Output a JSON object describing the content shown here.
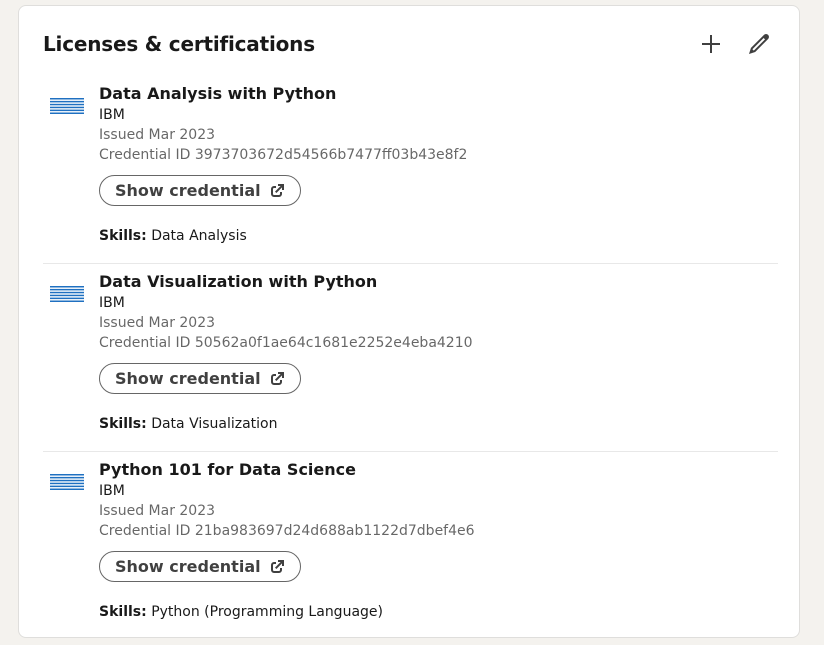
{
  "section": {
    "title": "Licenses & certifications",
    "add_icon": "plus-icon",
    "edit_icon": "pencil-icon"
  },
  "skills_label": "Skills:",
  "certs": [
    {
      "name": "Data Analysis with Python",
      "issuer": "IBM",
      "issued": "Issued Mar 2023",
      "credential": "Credential ID 3973703672d54566b7477ff03b43e8f2",
      "button": "Show credential",
      "skills": "Data Analysis",
      "logo": "IBM"
    },
    {
      "name": "Data Visualization with Python",
      "issuer": "IBM",
      "issued": "Issued Mar 2023",
      "credential": "Credential ID 50562a0f1ae64c1681e2252e4eba4210",
      "button": "Show credential",
      "skills": "Data Visualization",
      "logo": "IBM"
    },
    {
      "name": "Python 101 for Data Science",
      "issuer": "IBM",
      "issued": "Issued Mar 2023",
      "credential": "Credential ID 21ba983697d24d688ab1122d7dbef4e6",
      "button": "Show credential",
      "skills": "Python (Programming Language)",
      "logo": "IBM"
    }
  ],
  "colors": {
    "ibm_blue": "#1f70c1",
    "background": "#f4f2ee"
  }
}
